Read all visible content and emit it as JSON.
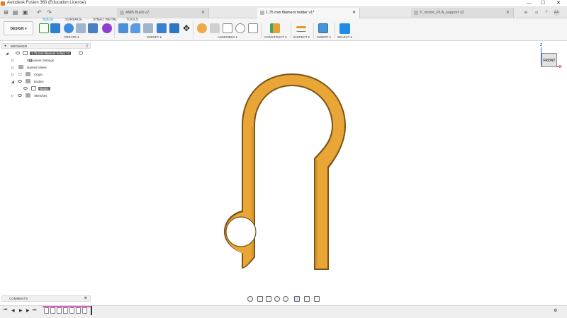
{
  "window": {
    "title": "Autodesk Fusion 360 (Education License)",
    "controls": [
      "—",
      "☐",
      "✕"
    ]
  },
  "tabs": [
    {
      "label": "AMB Build v2",
      "active": false
    },
    {
      "label": "1.75 mm filament holder v1*",
      "active": true
    },
    {
      "label": "Y_motor_PLA_support v2",
      "active": false
    }
  ],
  "account": {
    "initials": "AA"
  },
  "ribbon": {
    "workspace": "DESIGN ▾",
    "tabs": [
      {
        "label": "SOLID",
        "active": true
      },
      {
        "label": "SURFACE",
        "active": false
      },
      {
        "label": "SHEET METAL",
        "active": false
      },
      {
        "label": "TOOLS",
        "active": false
      }
    ],
    "groups": [
      {
        "label": "CREATE ▾"
      },
      {
        "label": "MODIFY ▾"
      },
      {
        "label": "ASSEMBLE ▾"
      },
      {
        "label": "CONSTRUCT ▾"
      },
      {
        "label": "INSPECT ▾"
      },
      {
        "label": "INSERT ▾"
      },
      {
        "label": "SELECT ▾"
      }
    ]
  },
  "browser": {
    "title": "BROWSER",
    "items": [
      {
        "label": "1.75 mm filament holder v1"
      },
      {
        "label": "Document Settings"
      },
      {
        "label": "Named Views"
      },
      {
        "label": "Origin"
      },
      {
        "label": "Bodies"
      },
      {
        "label": "Body1"
      },
      {
        "label": "Sketches"
      }
    ]
  },
  "comments": {
    "title": "COMMENTS"
  },
  "viewcube": {
    "face": "FRONT",
    "axis_z": "Z",
    "axis_x": "X"
  },
  "colors": {
    "body_fill": "#e9a536",
    "body_edge": "#7a5416",
    "accent": "#0696d7",
    "timeline_marker": "#e35ec8"
  }
}
